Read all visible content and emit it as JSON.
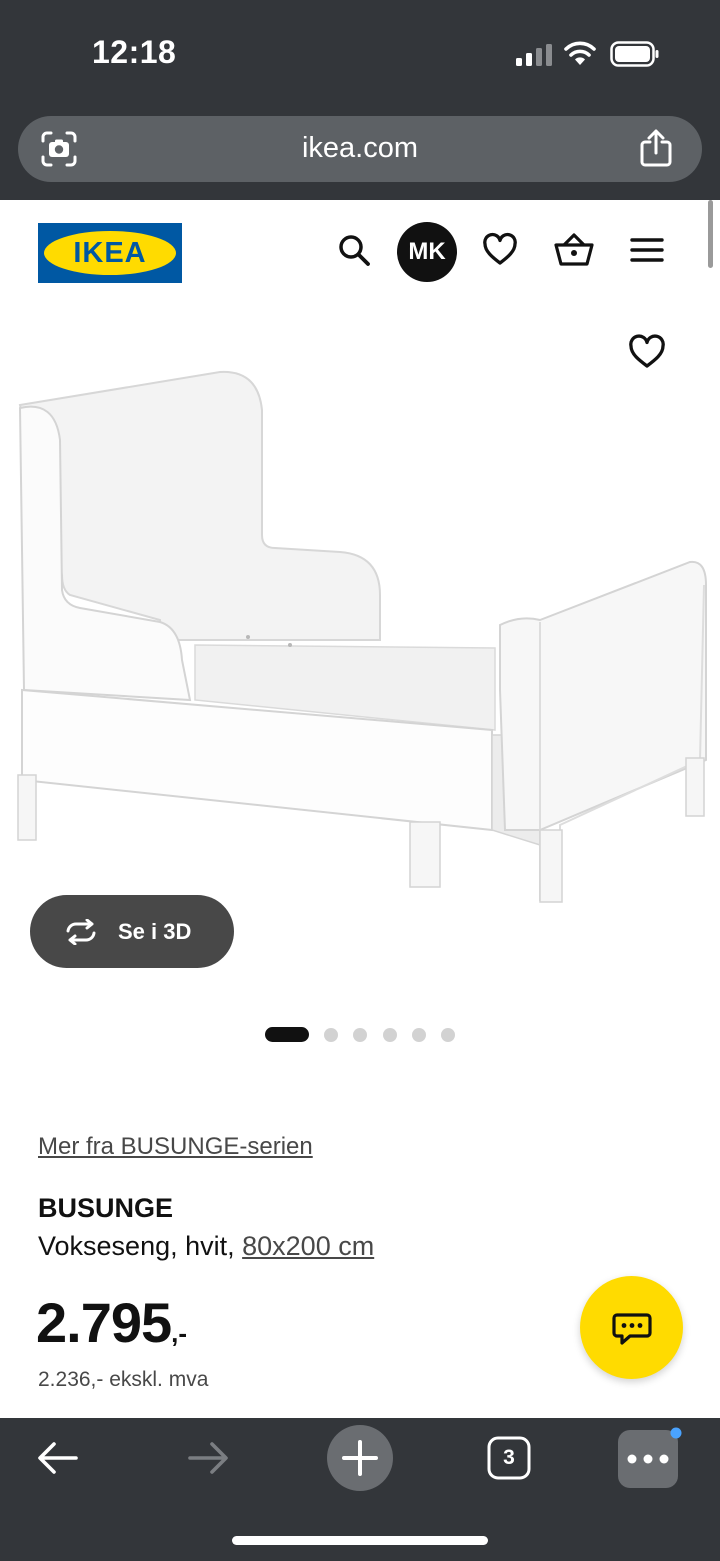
{
  "status_bar": {
    "time": "12:18"
  },
  "browser": {
    "url": "ikea.com",
    "tab_count": "3"
  },
  "header": {
    "logo_text": "IKEA",
    "avatar_initials": "MK"
  },
  "gallery": {
    "view_3d_label": "Se i 3D",
    "image_count": 6,
    "active_index": 0
  },
  "product": {
    "series_link": "Mer fra BUSUNGE-serien",
    "name": "BUSUNGE",
    "description": "Vokseseng, hvit, ",
    "size_link": "80x200 cm",
    "price_main": "2.795",
    "price_suffix": ",-",
    "price_ex_vat": "2.236,- ekskl. mva"
  },
  "colors": {
    "brand_blue": "#0058a3",
    "brand_yellow": "#ffdb00",
    "browser_chrome": "#33363a"
  }
}
